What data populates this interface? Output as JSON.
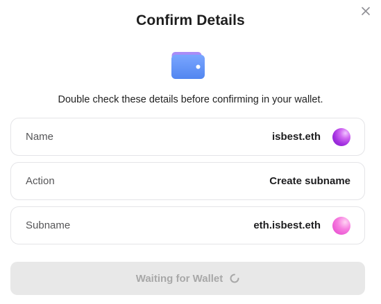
{
  "modal": {
    "title": "Confirm Details",
    "subtitle": "Double check these details before confirming in your wallet.",
    "close_icon": "close-icon",
    "wallet_icon": "wallet-icon"
  },
  "details": [
    {
      "label": "Name",
      "value": "isbest.eth",
      "avatar": "purple-gradient"
    },
    {
      "label": "Action",
      "value": "Create subname"
    },
    {
      "label": "Subname",
      "value": "eth.isbest.eth",
      "avatar": "pink-gradient"
    }
  ],
  "button": {
    "label": "Waiting for Wallet",
    "state": "disabled",
    "icon": "spinner-icon"
  },
  "colors": {
    "wallet_blue": "#5f8ff3",
    "button_bg": "#e8e8e8",
    "button_text": "#a8a8a8",
    "avatar_purple": "#a22fe0",
    "avatar_pink": "#ec5ad4"
  }
}
